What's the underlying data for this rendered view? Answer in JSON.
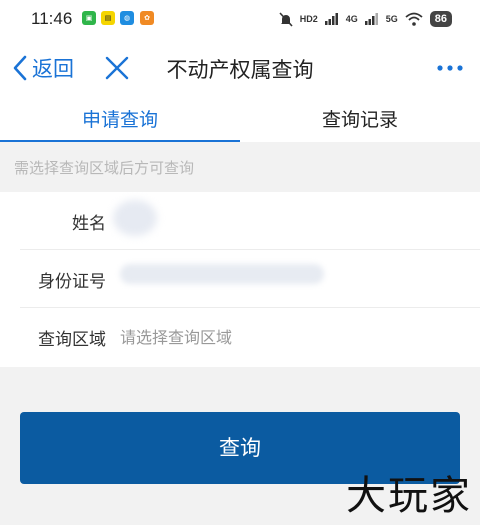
{
  "status_bar": {
    "time": "11:46",
    "network_tags": [
      "HD2",
      "4G",
      "5G"
    ],
    "battery": "86"
  },
  "nav": {
    "back_label": "返回",
    "title": "不动产权属查询"
  },
  "tabs": [
    {
      "label": "申请查询",
      "active": true
    },
    {
      "label": "查询记录",
      "active": false
    }
  ],
  "hint": "需选择查询区域后方可查询",
  "form": {
    "name_label": "姓名",
    "id_label": "身份证号",
    "region_label": "查询区域",
    "region_placeholder": "请选择查询区域"
  },
  "submit_label": "查询",
  "watermark": "大玩家",
  "colors": {
    "accent": "#1a73d6",
    "button": "#0b5ba1",
    "background": "#f2f2f2"
  }
}
